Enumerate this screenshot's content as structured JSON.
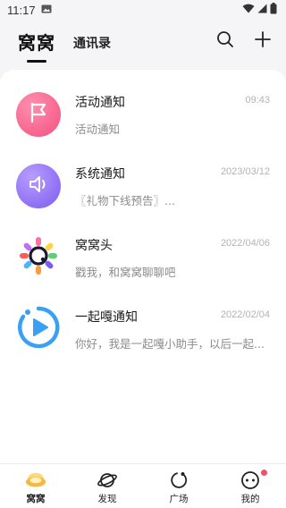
{
  "status_bar": {
    "time": "11:17"
  },
  "header": {
    "active_tab": "窝窝",
    "inactive_tab": "通讯录"
  },
  "messages": [
    {
      "title": "活动通知",
      "time": "09:43",
      "preview": "活动通知",
      "icon": "flag-icon",
      "color": "#f2638b"
    },
    {
      "title": "系统通知",
      "time": "2023/03/12",
      "preview": "〖礼物下线预告〗...",
      "icon": "speaker-icon",
      "color": "#8c6bf2"
    },
    {
      "title": "窝窝头",
      "time": "2022/04/06",
      "preview": "戳我，和窝窝聊聊吧",
      "icon": "wowotou-logo-icon",
      "color": "#1a1a2e"
    },
    {
      "title": "一起嘎通知",
      "time": "2022/02/04",
      "preview": "你好，我是一起嘎小助手，以后一起...",
      "icon": "play-icon",
      "color": "#2b9af3"
    }
  ],
  "bottom_nav": [
    {
      "label": "窝窝",
      "icon": "nest-icon",
      "active": true
    },
    {
      "label": "发现",
      "icon": "planet-icon",
      "active": false
    },
    {
      "label": "广场",
      "icon": "square-icon",
      "active": false
    },
    {
      "label": "我的",
      "icon": "profile-icon",
      "active": false,
      "badge": true
    }
  ]
}
